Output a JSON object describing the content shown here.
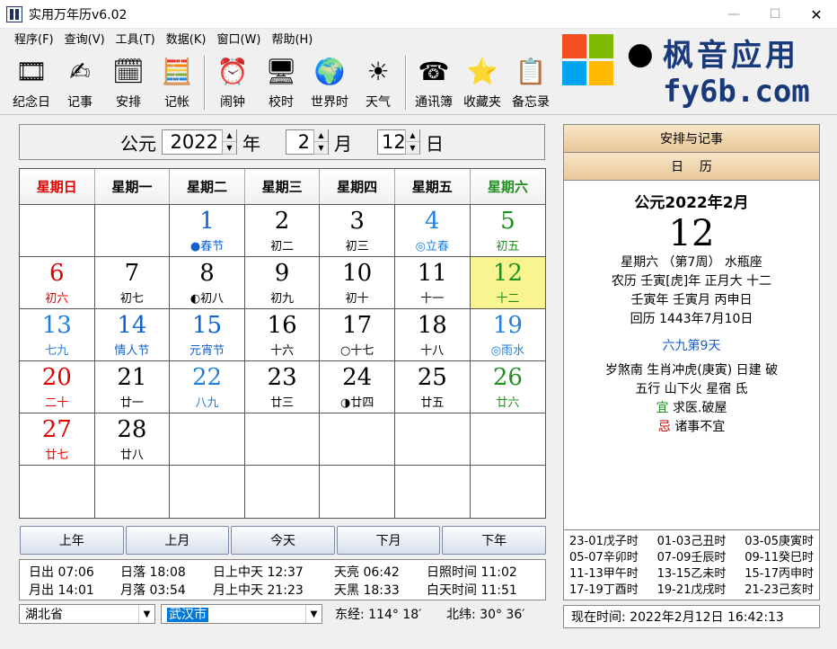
{
  "window": {
    "title": "实用万年历v6.02",
    "min": "—",
    "max": "☐",
    "close": "✕"
  },
  "menu": [
    "程序(F)",
    "查询(V)",
    "工具(T)",
    "数据(K)",
    "窗口(W)",
    "帮助(H)"
  ],
  "toolbar": [
    {
      "label": "纪念日",
      "icon": "commemorative-day-icon",
      "glyph": "🎞"
    },
    {
      "label": "记事",
      "icon": "notes-icon",
      "glyph": "✍"
    },
    {
      "label": "安排",
      "icon": "schedule-icon",
      "glyph": "🗓"
    },
    {
      "label": "记帐",
      "icon": "accounting-icon",
      "glyph": "🧮"
    },
    {
      "label": "闹钟",
      "icon": "alarm-clock-icon",
      "glyph": "⏰"
    },
    {
      "label": "校时",
      "icon": "time-sync-icon",
      "glyph": "🖥"
    },
    {
      "label": "世界时",
      "icon": "world-time-icon",
      "glyph": "🌍"
    },
    {
      "label": "天气",
      "icon": "weather-icon",
      "glyph": "☀"
    },
    {
      "label": "通讯簿",
      "icon": "address-book-icon",
      "glyph": "☎"
    },
    {
      "label": "收藏夹",
      "icon": "favorites-icon",
      "glyph": "⭐"
    },
    {
      "label": "备忘录",
      "icon": "memo-icon",
      "glyph": "📋"
    }
  ],
  "watermark": {
    "text": "枫音应用",
    "url": "fy6b.com"
  },
  "datebar": {
    "era": "公元",
    "year": "2022",
    "year_unit": "年",
    "month": "2",
    "month_unit": "月",
    "day": "12",
    "day_unit": "日"
  },
  "weekdays": [
    "星期日",
    "星期一",
    "星期二",
    "星期三",
    "星期四",
    "星期五",
    "星期六"
  ],
  "colors": {
    "red": "#e00000",
    "green": "#1f8f1f",
    "blue": "#1060d0",
    "black": "#000000",
    "lightblue": "#2080e0"
  },
  "days": [
    {
      "n": "",
      "l": ""
    },
    {
      "n": "",
      "l": ""
    },
    {
      "n": "1",
      "l": "●春节",
      "nc": "blue",
      "lc": "blue"
    },
    {
      "n": "2",
      "l": "初二"
    },
    {
      "n": "3",
      "l": "初三"
    },
    {
      "n": "4",
      "l": "◎立春",
      "nc": "lightblue",
      "lc": "lightblue"
    },
    {
      "n": "5",
      "l": "初五",
      "nc": "green",
      "lc": "green"
    },
    {
      "n": "6",
      "l": "初六",
      "nc": "red",
      "lc": "red"
    },
    {
      "n": "7",
      "l": "初七"
    },
    {
      "n": "8",
      "l": "◐初八"
    },
    {
      "n": "9",
      "l": "初九"
    },
    {
      "n": "10",
      "l": "初十"
    },
    {
      "n": "11",
      "l": "十一"
    },
    {
      "n": "12",
      "l": "十二",
      "nc": "green",
      "lc": "green",
      "today": true
    },
    {
      "n": "13",
      "l": "七九",
      "nc": "lightblue",
      "lc": "lightblue"
    },
    {
      "n": "14",
      "l": "情人节",
      "nc": "blue",
      "lc": "blue"
    },
    {
      "n": "15",
      "l": "元宵节",
      "nc": "blue",
      "lc": "blue"
    },
    {
      "n": "16",
      "l": "十六"
    },
    {
      "n": "17",
      "l": "○十七"
    },
    {
      "n": "18",
      "l": "十八"
    },
    {
      "n": "19",
      "l": "◎雨水",
      "nc": "lightblue",
      "lc": "lightblue"
    },
    {
      "n": "20",
      "l": "二十",
      "nc": "red",
      "lc": "red"
    },
    {
      "n": "21",
      "l": "廿一"
    },
    {
      "n": "22",
      "l": "八九",
      "nc": "lightblue",
      "lc": "lightblue"
    },
    {
      "n": "23",
      "l": "廿三"
    },
    {
      "n": "24",
      "l": "◑廿四"
    },
    {
      "n": "25",
      "l": "廿五"
    },
    {
      "n": "26",
      "l": "廿六",
      "nc": "green",
      "lc": "green"
    },
    {
      "n": "27",
      "l": "廿七",
      "nc": "red",
      "lc": "red"
    },
    {
      "n": "28",
      "l": "廿八"
    },
    {
      "n": "",
      "l": ""
    },
    {
      "n": "",
      "l": ""
    },
    {
      "n": "",
      "l": ""
    },
    {
      "n": "",
      "l": ""
    },
    {
      "n": "",
      "l": ""
    },
    {
      "n": "",
      "l": ""
    },
    {
      "n": "",
      "l": ""
    },
    {
      "n": "",
      "l": ""
    },
    {
      "n": "",
      "l": ""
    },
    {
      "n": "",
      "l": ""
    },
    {
      "n": "",
      "l": ""
    },
    {
      "n": "",
      "l": ""
    }
  ],
  "nav": [
    "上年",
    "上月",
    "今天",
    "下月",
    "下年"
  ],
  "sun": {
    "row1": [
      "日出 07:06",
      "日落 18:08",
      "日上中天 12:37",
      "天亮 06:42",
      "日照时间 11:02"
    ],
    "row2": [
      "月出 14:01",
      "月落 03:54",
      "月上中天 21:23",
      "天黑 18:33",
      "白天时间 11:51"
    ]
  },
  "location": {
    "province": "湖北省",
    "city": "武汉市",
    "lon": "东经: 114° 18′",
    "lat": "北纬: 30° 36′"
  },
  "right": {
    "tab1": "安排与记事",
    "tab2": "日    历",
    "title": "公元2022年2月",
    "day": "12",
    "lines": [
      "星期六 （第7周） 水瓶座",
      "农历 壬寅[虎]年 正月大 十二",
      "壬寅年 壬寅月 丙申日",
      "回历 1443年7月10日"
    ],
    "jieqi": "六九第9天",
    "lines2": [
      "岁煞南 生肖冲虎(庚寅)  日建 破",
      "五行 山下火   星宿 氐"
    ],
    "yi_label": "宜",
    "yi": "求医.破屋",
    "ji_label": "忌",
    "ji": "诸事不宜",
    "hours": [
      [
        "23-01戊子时",
        "01-03己丑时",
        "03-05庚寅时"
      ],
      [
        "05-07辛卯时",
        "07-09壬辰时",
        "09-11癸巳时"
      ],
      [
        "11-13甲午时",
        "13-15乙未时",
        "15-17丙申时"
      ],
      [
        "17-19丁酉时",
        "19-21戊戌时",
        "21-23己亥时"
      ]
    ],
    "now": "现在时间: 2022年2月12日  16:42:13"
  }
}
